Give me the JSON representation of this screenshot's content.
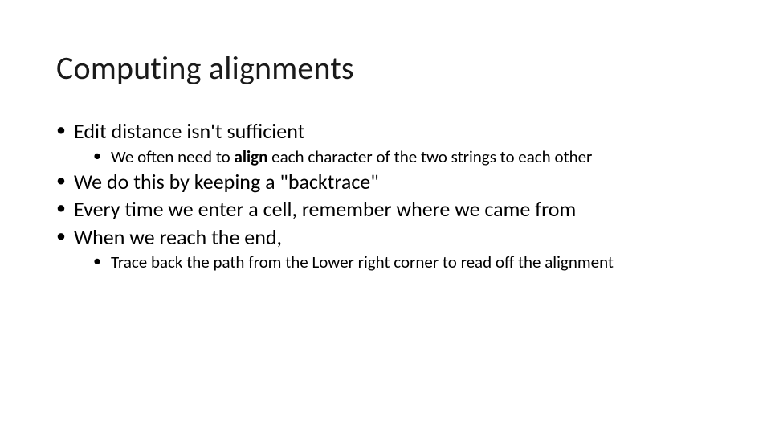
{
  "title": "Computing alignments",
  "bullets": {
    "b1": "Edit distance isn't sufficient",
    "b1_sub1_pre": "We often need to ",
    "b1_sub1_bold": "align",
    "b1_sub1_post": " each character of the two strings to each other",
    "b2": "We do this by keeping a \"backtrace\"",
    "b3": "Every time we enter a cell, remember where we came from",
    "b4": "When we reach the end,",
    "b4_sub1": "Trace back the path from the Lower  right corner to read off the alignment"
  }
}
